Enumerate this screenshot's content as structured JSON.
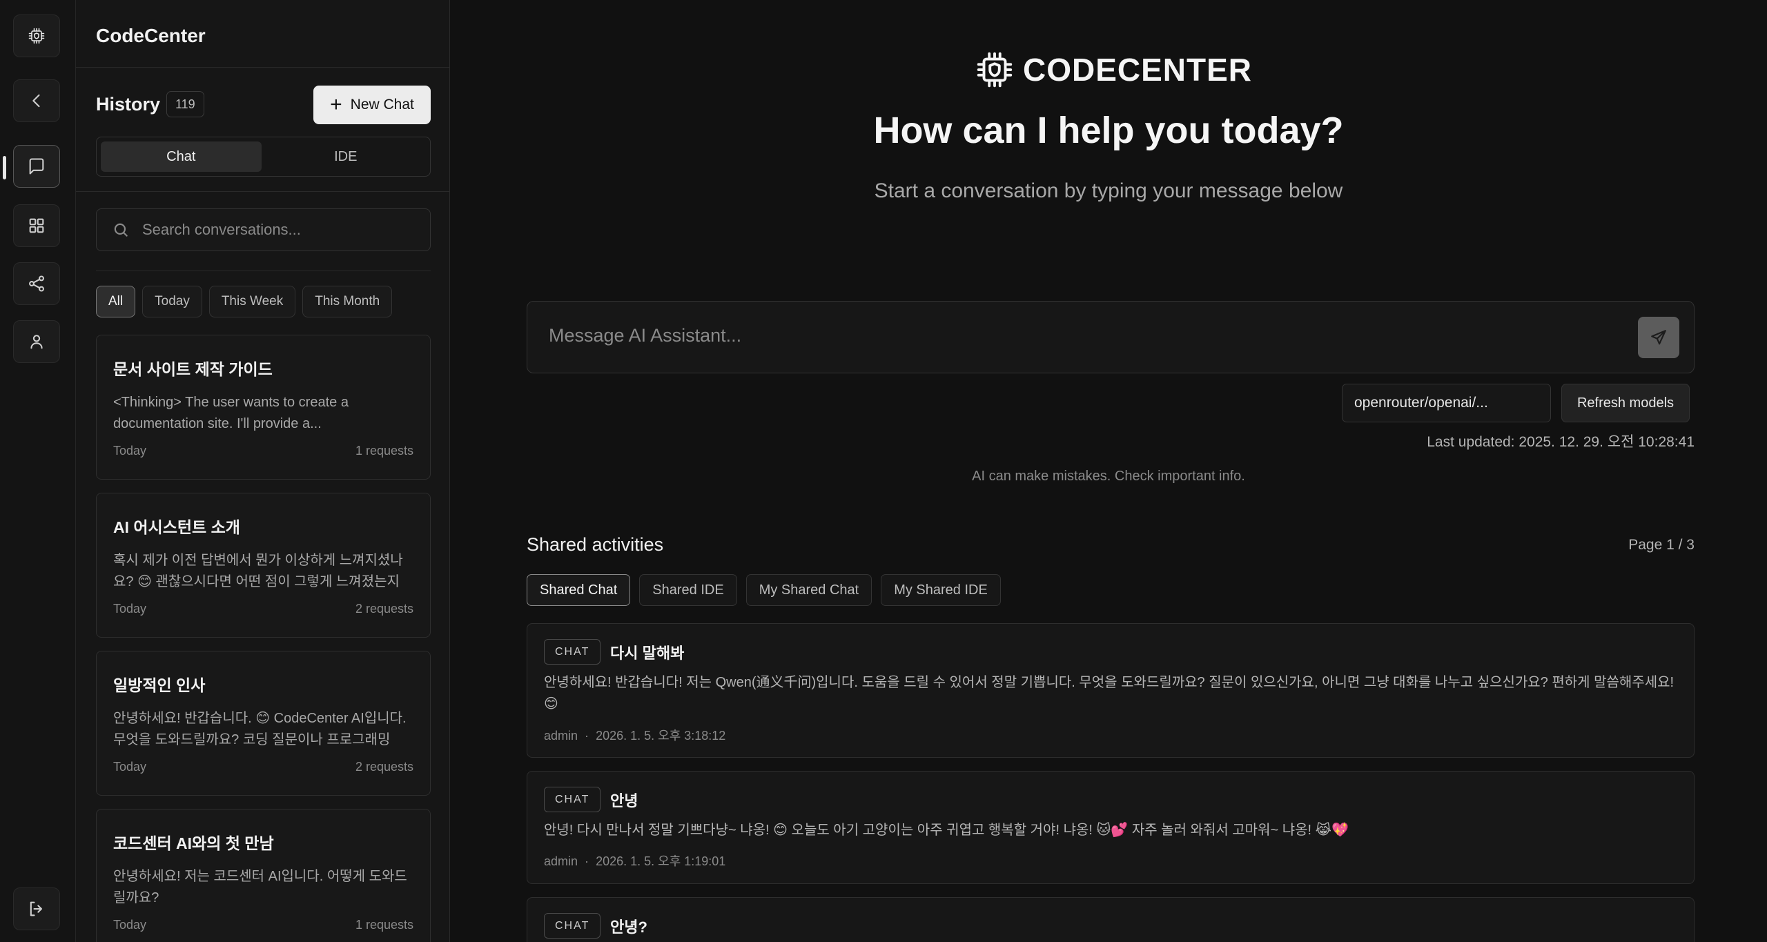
{
  "app": {
    "name": "CodeCenter",
    "brand_wordmark": "CODECENTER"
  },
  "rail": {
    "items": [
      "collapse-sidebar",
      "chat",
      "apps",
      "share",
      "profile",
      "logout"
    ]
  },
  "history": {
    "label": "History",
    "count": "119",
    "new_chat_label": "New Chat",
    "segments": [
      {
        "label": "Chat",
        "active": true
      },
      {
        "label": "IDE",
        "active": false
      }
    ],
    "search_placeholder": "Search conversations...",
    "filters": [
      {
        "label": "All",
        "active": true
      },
      {
        "label": "Today",
        "active": false
      },
      {
        "label": "This Week",
        "active": false
      },
      {
        "label": "This Month",
        "active": false
      }
    ],
    "items": [
      {
        "title": "문서 사이트 제작 가이드",
        "preview": "<Thinking> The user wants to create a documentation site. I'll provide a...",
        "date": "Today",
        "requests": "1 requests"
      },
      {
        "title": "AI 어시스턴트 소개",
        "preview": "혹시 제가 이전 답변에서 뭔가 이상하게 느껴지셨나요? 😊 괜찮으시다면 어떤 점이 그렇게 느껴졌는지 알려...",
        "date": "Today",
        "requests": "2 requests"
      },
      {
        "title": "일방적인 인사",
        "preview": "안녕하세요! 반갑습니다. 😊 CodeCenter AI입니다. 무엇을 도와드릴까요? 코딩 질문이나 프로그래밍 관...",
        "date": "Today",
        "requests": "2 requests"
      },
      {
        "title": "코드센터 AI와의 첫 만남",
        "preview": "안녕하세요! 저는 코드센터 AI입니다. 어떻게 도와드릴까요?",
        "date": "Today",
        "requests": "1 requests"
      }
    ]
  },
  "main": {
    "headline": "How can I help you today?",
    "subheadline": "Start a conversation by typing your message below",
    "composer_placeholder": "Message AI Assistant...",
    "model_value": "openrouter/openai/...",
    "refresh_label": "Refresh models",
    "last_updated": "Last updated: 2025. 12. 29. 오전 10:28:41",
    "disclaimer": "AI can make mistakes. Check important info.",
    "shared": {
      "title": "Shared activities",
      "page": "Page 1 / 3",
      "tabs": [
        {
          "label": "Shared Chat",
          "active": true
        },
        {
          "label": "Shared IDE",
          "active": false
        },
        {
          "label": "My Shared Chat",
          "active": false
        },
        {
          "label": "My Shared IDE",
          "active": false
        }
      ],
      "items": [
        {
          "badge": "CHAT",
          "title": "다시 말해봐",
          "body": "안녕하세요! 반갑습니다! 저는 Qwen(通义千问)입니다. 도움을 드릴 수 있어서 정말 기쁩니다. 무엇을 도와드릴까요? 질문이 있으신가요, 아니면 그냥 대화를 나누고 싶으신가요? 편하게 말씀해주세요! 😊",
          "author": "admin",
          "time": "2026. 1. 5. 오후 3:18:12"
        },
        {
          "badge": "CHAT",
          "title": "안녕",
          "body": "안녕! 다시 만나서 정말 기쁘다냥~ 냐옹! 😊 오늘도 아기 고양이는 아주 귀엽고 행복할 거야! 냐옹! 🐱💕 자주 놀러 와줘서 고마워~ 냐옹! 😹💖",
          "author": "admin",
          "time": "2026. 1. 5. 오후 1:19:01"
        },
        {
          "badge": "CHAT",
          "title": "안녕?",
          "body": "",
          "author": "",
          "time": ""
        }
      ]
    }
  }
}
